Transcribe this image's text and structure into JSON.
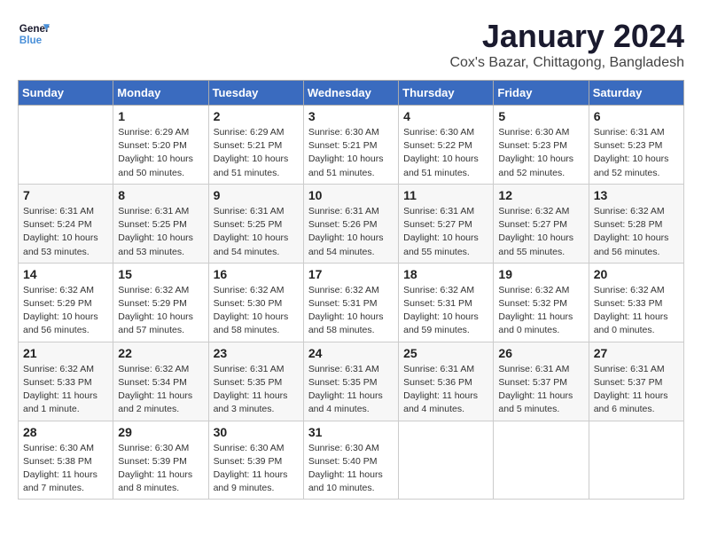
{
  "header": {
    "logo_line1": "General",
    "logo_line2": "Blue",
    "month_year": "January 2024",
    "location": "Cox's Bazar, Chittagong, Bangladesh"
  },
  "weekdays": [
    "Sunday",
    "Monday",
    "Tuesday",
    "Wednesday",
    "Thursday",
    "Friday",
    "Saturday"
  ],
  "weeks": [
    [
      {
        "day": "",
        "info": ""
      },
      {
        "day": "1",
        "info": "Sunrise: 6:29 AM\nSunset: 5:20 PM\nDaylight: 10 hours\nand 50 minutes."
      },
      {
        "day": "2",
        "info": "Sunrise: 6:29 AM\nSunset: 5:21 PM\nDaylight: 10 hours\nand 51 minutes."
      },
      {
        "day": "3",
        "info": "Sunrise: 6:30 AM\nSunset: 5:21 PM\nDaylight: 10 hours\nand 51 minutes."
      },
      {
        "day": "4",
        "info": "Sunrise: 6:30 AM\nSunset: 5:22 PM\nDaylight: 10 hours\nand 51 minutes."
      },
      {
        "day": "5",
        "info": "Sunrise: 6:30 AM\nSunset: 5:23 PM\nDaylight: 10 hours\nand 52 minutes."
      },
      {
        "day": "6",
        "info": "Sunrise: 6:31 AM\nSunset: 5:23 PM\nDaylight: 10 hours\nand 52 minutes."
      }
    ],
    [
      {
        "day": "7",
        "info": "Sunrise: 6:31 AM\nSunset: 5:24 PM\nDaylight: 10 hours\nand 53 minutes."
      },
      {
        "day": "8",
        "info": "Sunrise: 6:31 AM\nSunset: 5:25 PM\nDaylight: 10 hours\nand 53 minutes."
      },
      {
        "day": "9",
        "info": "Sunrise: 6:31 AM\nSunset: 5:25 PM\nDaylight: 10 hours\nand 54 minutes."
      },
      {
        "day": "10",
        "info": "Sunrise: 6:31 AM\nSunset: 5:26 PM\nDaylight: 10 hours\nand 54 minutes."
      },
      {
        "day": "11",
        "info": "Sunrise: 6:31 AM\nSunset: 5:27 PM\nDaylight: 10 hours\nand 55 minutes."
      },
      {
        "day": "12",
        "info": "Sunrise: 6:32 AM\nSunset: 5:27 PM\nDaylight: 10 hours\nand 55 minutes."
      },
      {
        "day": "13",
        "info": "Sunrise: 6:32 AM\nSunset: 5:28 PM\nDaylight: 10 hours\nand 56 minutes."
      }
    ],
    [
      {
        "day": "14",
        "info": "Sunrise: 6:32 AM\nSunset: 5:29 PM\nDaylight: 10 hours\nand 56 minutes."
      },
      {
        "day": "15",
        "info": "Sunrise: 6:32 AM\nSunset: 5:29 PM\nDaylight: 10 hours\nand 57 minutes."
      },
      {
        "day": "16",
        "info": "Sunrise: 6:32 AM\nSunset: 5:30 PM\nDaylight: 10 hours\nand 58 minutes."
      },
      {
        "day": "17",
        "info": "Sunrise: 6:32 AM\nSunset: 5:31 PM\nDaylight: 10 hours\nand 58 minutes."
      },
      {
        "day": "18",
        "info": "Sunrise: 6:32 AM\nSunset: 5:31 PM\nDaylight: 10 hours\nand 59 minutes."
      },
      {
        "day": "19",
        "info": "Sunrise: 6:32 AM\nSunset: 5:32 PM\nDaylight: 11 hours\nand 0 minutes."
      },
      {
        "day": "20",
        "info": "Sunrise: 6:32 AM\nSunset: 5:33 PM\nDaylight: 11 hours\nand 0 minutes."
      }
    ],
    [
      {
        "day": "21",
        "info": "Sunrise: 6:32 AM\nSunset: 5:33 PM\nDaylight: 11 hours\nand 1 minute."
      },
      {
        "day": "22",
        "info": "Sunrise: 6:32 AM\nSunset: 5:34 PM\nDaylight: 11 hours\nand 2 minutes."
      },
      {
        "day": "23",
        "info": "Sunrise: 6:31 AM\nSunset: 5:35 PM\nDaylight: 11 hours\nand 3 minutes."
      },
      {
        "day": "24",
        "info": "Sunrise: 6:31 AM\nSunset: 5:35 PM\nDaylight: 11 hours\nand 4 minutes."
      },
      {
        "day": "25",
        "info": "Sunrise: 6:31 AM\nSunset: 5:36 PM\nDaylight: 11 hours\nand 4 minutes."
      },
      {
        "day": "26",
        "info": "Sunrise: 6:31 AM\nSunset: 5:37 PM\nDaylight: 11 hours\nand 5 minutes."
      },
      {
        "day": "27",
        "info": "Sunrise: 6:31 AM\nSunset: 5:37 PM\nDaylight: 11 hours\nand 6 minutes."
      }
    ],
    [
      {
        "day": "28",
        "info": "Sunrise: 6:30 AM\nSunset: 5:38 PM\nDaylight: 11 hours\nand 7 minutes."
      },
      {
        "day": "29",
        "info": "Sunrise: 6:30 AM\nSunset: 5:39 PM\nDaylight: 11 hours\nand 8 minutes."
      },
      {
        "day": "30",
        "info": "Sunrise: 6:30 AM\nSunset: 5:39 PM\nDaylight: 11 hours\nand 9 minutes."
      },
      {
        "day": "31",
        "info": "Sunrise: 6:30 AM\nSunset: 5:40 PM\nDaylight: 11 hours\nand 10 minutes."
      },
      {
        "day": "",
        "info": ""
      },
      {
        "day": "",
        "info": ""
      },
      {
        "day": "",
        "info": ""
      }
    ]
  ]
}
